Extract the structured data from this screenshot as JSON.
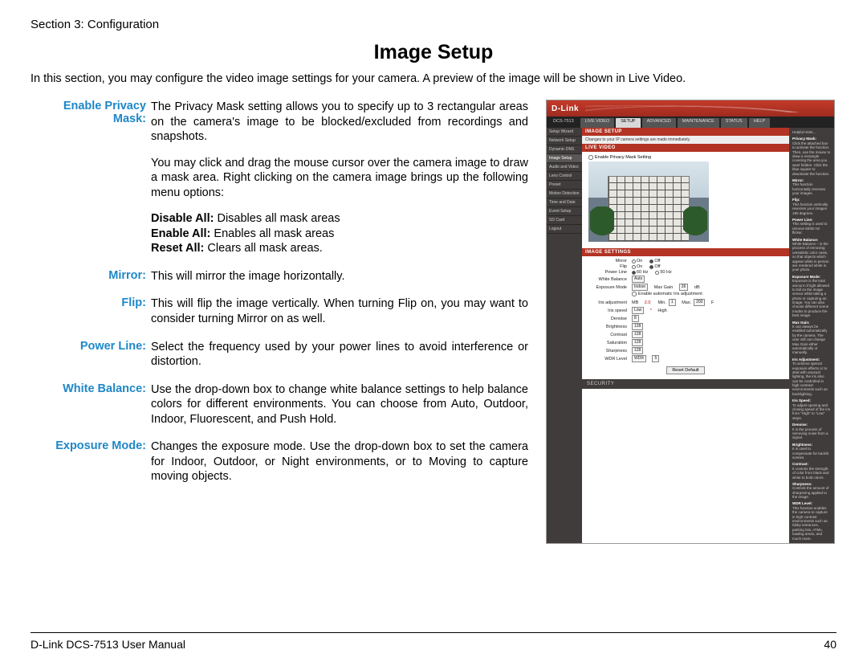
{
  "header": {
    "section": "Section 3: Configuration"
  },
  "title": "Image Setup",
  "intro": "In this section, you may configure the video image settings for your camera. A preview of the image will be shown in Live Video.",
  "defs": {
    "privacy": {
      "label": "Enable Privacy Mask:",
      "p1": "The Privacy Mask setting allows you to specify up to 3 rectangular areas on the camera's image to be blocked/excluded from recordings and snapshots.",
      "p2": "You may click and drag the mouse cursor over the camera image to draw a mask area. Right clicking on the camera image brings up the following menu options:",
      "disable_b": "Disable All:",
      "disable_t": " Disables all mask areas",
      "enable_b": "Enable All:",
      "enable_t": " Enables all mask areas",
      "reset_b": "Reset All:",
      "reset_t": " Clears all mask areas."
    },
    "mirror": {
      "label": "Mirror:",
      "t": "This will mirror the image horizontally."
    },
    "flip": {
      "label": "Flip:",
      "t": "This will flip the image vertically. When turning Flip on, you may want to consider turning Mirror on as well."
    },
    "power": {
      "label": "Power Line:",
      "t": "Select the frequency used by your power lines to avoid interference or distortion."
    },
    "wb": {
      "label": "White Balance:",
      "t": "Use the drop-down box to change white balance settings to help balance colors for different environments. You can choose from Auto, Outdoor, Indoor, Fluorescent, and Push Hold."
    },
    "exp": {
      "label": "Exposure Mode:",
      "t": "Changes the exposure mode. Use the drop-down box to set the camera for Indoor, Outdoor, or Night environments, or to Moving to capture moving objects."
    }
  },
  "footer": {
    "left": "D-Link DCS-7513 User Manual",
    "right": "40"
  },
  "shot": {
    "brand": "D-Link",
    "model": "DCS-7513",
    "tabs": [
      "LIVE VIDEO",
      "SETUP",
      "ADVANCED",
      "MAINTENANCE",
      "STATUS",
      "HELP"
    ],
    "active_tab": 1,
    "sidebar": [
      "Setup Wizard",
      "Network Setup",
      "Dynamic DNS",
      "Image Setup",
      "Audio and Video",
      "Lens Control",
      "Preset",
      "Motion Detection",
      "Time and Date",
      "Event Setup",
      "SD Card",
      "Logout"
    ],
    "sidebar_active": 3,
    "strip1": "IMAGE SETUP",
    "note": "Changes to your IP camera settings are made immediately.",
    "strip2": "LIVE VIDEO",
    "chk_privacy": "Enable Privacy Mask Setting",
    "strip3": "IMAGE SETTINGS",
    "rows": {
      "mirror": "Mirror",
      "flip": "Flip",
      "power": "Power Line",
      "wb": "White Balance",
      "expmode": "Exposure Mode",
      "autoiris": "Enable automatic Iris adjustment",
      "irisadj": "Iris adjustment",
      "irisspd": "Iris speed",
      "denoise": "Denoise",
      "bright": "Brightness",
      "contrast": "Contrast",
      "sat": "Saturation",
      "sharp": "Sharpness",
      "wdr": "WDR Level"
    },
    "opts": {
      "on": "On",
      "off": "Off",
      "hz60": "60 Hz",
      "hz50": "50 Hz",
      "auto": "Auto",
      "indoor": "Indoor",
      "maxgain": "Max Gain",
      "maxgain_v": "36",
      "db": "dB",
      "mb": "MB",
      "mb_v": "2.0",
      "min": "Min.",
      "minv": "1",
      "max": "Max.",
      "maxv": "200",
      "f": "F",
      "low": "Low",
      "high": "High",
      "v8": "8",
      "v128": "128",
      "wdr": "WDR",
      "wdrlvl": "5"
    },
    "reset_btn": "Reset Default",
    "security": "SECURITY",
    "help": {
      "head": "Helpful Hints…",
      "privacy": "Privacy Mask:",
      "privacy_t": "Click the attached box to activate the function. Then, use the mouse to draw a rectangle covering the area you want hidden. Click the blue square to deactivate the function.",
      "mirror": "Mirror:",
      "mirror_t": "This function horizontally reverses your images.",
      "flip": "Flip:",
      "flip_t": "This function vertically reverses your images 180 degrees.",
      "power": "Power Line:",
      "power_t": "This setting is used to remove 50/60 Hz flicker.",
      "wb": "White Balance:",
      "wb_t": "White Balance – is the process of removing unrealistic color casts, so that objects which appear white in person are rendered white in your photo.",
      "exp": "Exposure Mode:",
      "exp_t": "Exposure is the total amount of light allowed to fall on the image sensor while taking a photo or capturing an image. You can also choose different scene modes to produce the best image.",
      "maxg": "Max Gain:",
      "maxg_t": "It can always be enabled automatically by the camera. The user still can change Max Gain either automatically or manually.",
      "iris": "Iris Adjustment:",
      "iris_t": "To achieve special exposure effects or to deal with unusual lighting, the iris also can be controlled in high contrast environments such as backlighting.",
      "irisspd": "Iris Speed:",
      "irisspd_t": "To adjust opening and closing speed of the iris from \"High\" to \"Low\" steps.",
      "denoise": "Denoise:",
      "denoise_t": "It is the process of removing noise from a signal.",
      "bright": "Brightness:",
      "bright_t": "It is used to compensate for backlit scenes.",
      "contrast": "Contrast:",
      "contrast_t": "It controls the strength of color from black and white to bold colors.",
      "sharp": "Sharpness:",
      "sharp_t": "Controls the amount of sharpening applied to the image.",
      "wdr": "WDR Level:",
      "wdr_t": "This function enables the camera to capture in high contrast environments such as lobby entrances, parking lots, ATMs, loading areas, and much more."
    }
  }
}
